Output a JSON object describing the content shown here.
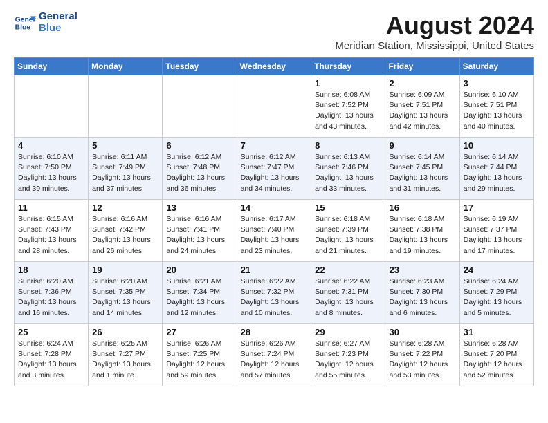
{
  "logo": {
    "line1": "General",
    "line2": "Blue"
  },
  "title": "August 2024",
  "location": "Meridian Station, Mississippi, United States",
  "days_of_week": [
    "Sunday",
    "Monday",
    "Tuesday",
    "Wednesday",
    "Thursday",
    "Friday",
    "Saturday"
  ],
  "weeks": [
    [
      {
        "day": "",
        "info": ""
      },
      {
        "day": "",
        "info": ""
      },
      {
        "day": "",
        "info": ""
      },
      {
        "day": "",
        "info": ""
      },
      {
        "day": "1",
        "info": "Sunrise: 6:08 AM\nSunset: 7:52 PM\nDaylight: 13 hours\nand 43 minutes."
      },
      {
        "day": "2",
        "info": "Sunrise: 6:09 AM\nSunset: 7:51 PM\nDaylight: 13 hours\nand 42 minutes."
      },
      {
        "day": "3",
        "info": "Sunrise: 6:10 AM\nSunset: 7:51 PM\nDaylight: 13 hours\nand 40 minutes."
      }
    ],
    [
      {
        "day": "4",
        "info": "Sunrise: 6:10 AM\nSunset: 7:50 PM\nDaylight: 13 hours\nand 39 minutes."
      },
      {
        "day": "5",
        "info": "Sunrise: 6:11 AM\nSunset: 7:49 PM\nDaylight: 13 hours\nand 37 minutes."
      },
      {
        "day": "6",
        "info": "Sunrise: 6:12 AM\nSunset: 7:48 PM\nDaylight: 13 hours\nand 36 minutes."
      },
      {
        "day": "7",
        "info": "Sunrise: 6:12 AM\nSunset: 7:47 PM\nDaylight: 13 hours\nand 34 minutes."
      },
      {
        "day": "8",
        "info": "Sunrise: 6:13 AM\nSunset: 7:46 PM\nDaylight: 13 hours\nand 33 minutes."
      },
      {
        "day": "9",
        "info": "Sunrise: 6:14 AM\nSunset: 7:45 PM\nDaylight: 13 hours\nand 31 minutes."
      },
      {
        "day": "10",
        "info": "Sunrise: 6:14 AM\nSunset: 7:44 PM\nDaylight: 13 hours\nand 29 minutes."
      }
    ],
    [
      {
        "day": "11",
        "info": "Sunrise: 6:15 AM\nSunset: 7:43 PM\nDaylight: 13 hours\nand 28 minutes."
      },
      {
        "day": "12",
        "info": "Sunrise: 6:16 AM\nSunset: 7:42 PM\nDaylight: 13 hours\nand 26 minutes."
      },
      {
        "day": "13",
        "info": "Sunrise: 6:16 AM\nSunset: 7:41 PM\nDaylight: 13 hours\nand 24 minutes."
      },
      {
        "day": "14",
        "info": "Sunrise: 6:17 AM\nSunset: 7:40 PM\nDaylight: 13 hours\nand 23 minutes."
      },
      {
        "day": "15",
        "info": "Sunrise: 6:18 AM\nSunset: 7:39 PM\nDaylight: 13 hours\nand 21 minutes."
      },
      {
        "day": "16",
        "info": "Sunrise: 6:18 AM\nSunset: 7:38 PM\nDaylight: 13 hours\nand 19 minutes."
      },
      {
        "day": "17",
        "info": "Sunrise: 6:19 AM\nSunset: 7:37 PM\nDaylight: 13 hours\nand 17 minutes."
      }
    ],
    [
      {
        "day": "18",
        "info": "Sunrise: 6:20 AM\nSunset: 7:36 PM\nDaylight: 13 hours\nand 16 minutes."
      },
      {
        "day": "19",
        "info": "Sunrise: 6:20 AM\nSunset: 7:35 PM\nDaylight: 13 hours\nand 14 minutes."
      },
      {
        "day": "20",
        "info": "Sunrise: 6:21 AM\nSunset: 7:34 PM\nDaylight: 13 hours\nand 12 minutes."
      },
      {
        "day": "21",
        "info": "Sunrise: 6:22 AM\nSunset: 7:32 PM\nDaylight: 13 hours\nand 10 minutes."
      },
      {
        "day": "22",
        "info": "Sunrise: 6:22 AM\nSunset: 7:31 PM\nDaylight: 13 hours\nand 8 minutes."
      },
      {
        "day": "23",
        "info": "Sunrise: 6:23 AM\nSunset: 7:30 PM\nDaylight: 13 hours\nand 6 minutes."
      },
      {
        "day": "24",
        "info": "Sunrise: 6:24 AM\nSunset: 7:29 PM\nDaylight: 13 hours\nand 5 minutes."
      }
    ],
    [
      {
        "day": "25",
        "info": "Sunrise: 6:24 AM\nSunset: 7:28 PM\nDaylight: 13 hours\nand 3 minutes."
      },
      {
        "day": "26",
        "info": "Sunrise: 6:25 AM\nSunset: 7:27 PM\nDaylight: 13 hours\nand 1 minute."
      },
      {
        "day": "27",
        "info": "Sunrise: 6:26 AM\nSunset: 7:25 PM\nDaylight: 12 hours\nand 59 minutes."
      },
      {
        "day": "28",
        "info": "Sunrise: 6:26 AM\nSunset: 7:24 PM\nDaylight: 12 hours\nand 57 minutes."
      },
      {
        "day": "29",
        "info": "Sunrise: 6:27 AM\nSunset: 7:23 PM\nDaylight: 12 hours\nand 55 minutes."
      },
      {
        "day": "30",
        "info": "Sunrise: 6:28 AM\nSunset: 7:22 PM\nDaylight: 12 hours\nand 53 minutes."
      },
      {
        "day": "31",
        "info": "Sunrise: 6:28 AM\nSunset: 7:20 PM\nDaylight: 12 hours\nand 52 minutes."
      }
    ]
  ]
}
